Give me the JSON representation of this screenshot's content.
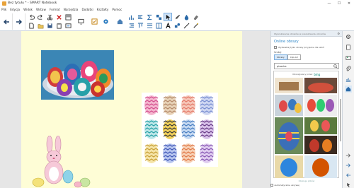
{
  "app": {
    "window_title": "Bez tytułu * - SMART Notebook"
  },
  "menu": [
    "Plik",
    "Edycja",
    "Widok",
    "Wstaw",
    "Format",
    "Narzędzia",
    "Dodatki",
    "Kształty",
    "Pomoc"
  ],
  "window_buttons": {
    "minimize": "—",
    "maximize": "☐",
    "close": "✕"
  },
  "gallery": {
    "header": "Wyszukiwanie obrazów w poszukiwaniu obrazów",
    "title": "Online obrazy",
    "safe_search_label": "Wyświetlaj tylko obrazy przyjazne dla szkół",
    "source_label": "Szukaj",
    "filters": [
      "Obrazy",
      "Clip Art"
    ],
    "search_value": "pisanka",
    "powered_by": "Obsługiwany przez",
    "engine": "bing",
    "footer": "Obsługa plików"
  },
  "bottom": {
    "auto_hide_label": "Automatycznie ukrywaj"
  },
  "colors": {
    "page_background": "#fefdd6",
    "accent": "#2f87c8",
    "workspace": "#e6e6e6"
  }
}
